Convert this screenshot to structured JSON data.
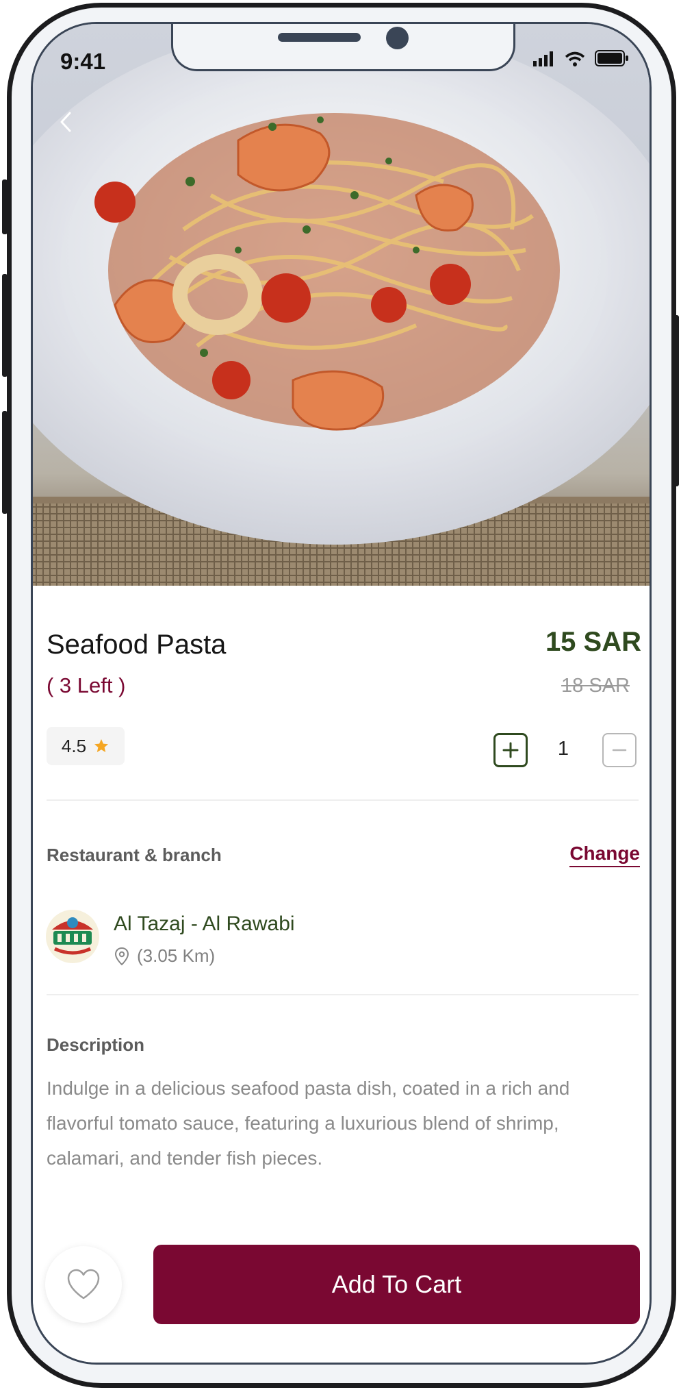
{
  "status_bar": {
    "time": "9:41"
  },
  "header": {
    "back_icon": "chevron-left-icon"
  },
  "product": {
    "name": "Seafood Pasta",
    "stock_left": "( 3 Left )",
    "price": "15 SAR",
    "old_price": "18 SAR",
    "rating": "4.5",
    "rating_icon": "star-icon",
    "quantity": "1"
  },
  "restaurant_section": {
    "label": "Restaurant & branch",
    "change_label": "Change",
    "restaurant_name": "Al Tazaj - Al Rawabi",
    "distance": "(3.05 Km)"
  },
  "description_section": {
    "label": "Description",
    "text": "Indulge in a delicious seafood pasta dish, coated in a rich and flavorful tomato sauce, featuring a luxurious blend of shrimp, calamari, and tender fish pieces."
  },
  "footer": {
    "add_to_cart_label": "Add To Cart",
    "favorite_icon": "heart-icon"
  },
  "colors": {
    "brand_primary": "#7a0832",
    "price_green": "#2f4a1f",
    "rating_star": "#f5a623"
  }
}
